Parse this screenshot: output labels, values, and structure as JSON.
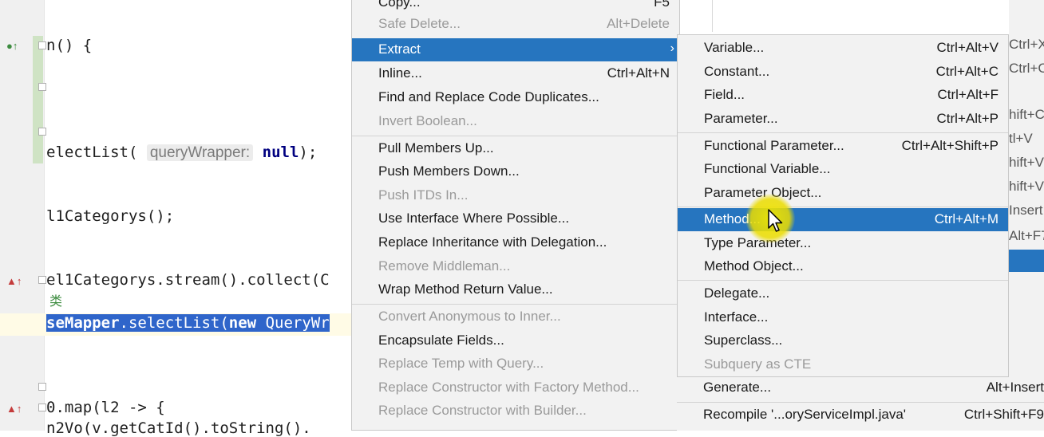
{
  "editor": {
    "lines": {
      "l1": "n() {",
      "l2_pre": "electList( ",
      "l2_hint": "queryWrapper:",
      "l2_kw": "null",
      "l2_post": ");",
      "l3": "l1Categorys();",
      "l4": "el1Categorys.stream().collect(C",
      "l5_cjk": "类",
      "l6_sel1": "seMapper",
      "l6_sel2": ".selectList(",
      "l6_sel3": "new",
      "l6_sel4": " QueryWr",
      "l7": "0.map(l2 -> {",
      "l8": "n2Vo(v.getCatId().toString()."
    }
  },
  "refactor_menu": {
    "items": [
      {
        "label": "Copy...",
        "shortcut": "F5"
      },
      {
        "label": "Safe Delete...",
        "shortcut": "Alt+Delete"
      },
      {
        "label": "Extract",
        "shortcut": "›"
      },
      {
        "label": "Inline...",
        "shortcut": "Ctrl+Alt+N"
      },
      {
        "label": "Find and Replace Code Duplicates...",
        "shortcut": ""
      },
      {
        "label": "Invert Boolean...",
        "shortcut": ""
      },
      {
        "label": "Pull Members Up...",
        "shortcut": ""
      },
      {
        "label": "Push Members Down...",
        "shortcut": ""
      },
      {
        "label": "Push ITDs In...",
        "shortcut": ""
      },
      {
        "label": "Use Interface Where Possible...",
        "shortcut": ""
      },
      {
        "label": "Replace Inheritance with Delegation...",
        "shortcut": ""
      },
      {
        "label": "Remove Middleman...",
        "shortcut": ""
      },
      {
        "label": "Wrap Method Return Value...",
        "shortcut": ""
      },
      {
        "label": "Convert Anonymous to Inner...",
        "shortcut": ""
      },
      {
        "label": "Encapsulate Fields...",
        "shortcut": ""
      },
      {
        "label": "Replace Temp with Query...",
        "shortcut": ""
      },
      {
        "label": "Replace Constructor with Factory Method...",
        "shortcut": ""
      },
      {
        "label": "Replace Constructor with Builder...",
        "shortcut": ""
      }
    ]
  },
  "extract_menu": {
    "items": [
      {
        "label": "Variable...",
        "shortcut": "Ctrl+Alt+V"
      },
      {
        "label": "Constant...",
        "shortcut": "Ctrl+Alt+C"
      },
      {
        "label": "Field...",
        "shortcut": "Ctrl+Alt+F"
      },
      {
        "label": "Parameter...",
        "shortcut": "Ctrl+Alt+P"
      },
      {
        "label": "Functional Parameter...",
        "shortcut": "Ctrl+Alt+Shift+P"
      },
      {
        "label": "Functional Variable...",
        "shortcut": ""
      },
      {
        "label": "Parameter Object...",
        "shortcut": ""
      },
      {
        "label": "Method...",
        "shortcut": "Ctrl+Alt+M"
      },
      {
        "label": "Type Parameter...",
        "shortcut": ""
      },
      {
        "label": "Method Object...",
        "shortcut": ""
      },
      {
        "label": "Delegate...",
        "shortcut": ""
      },
      {
        "label": "Interface...",
        "shortcut": ""
      },
      {
        "label": "Superclass...",
        "shortcut": ""
      },
      {
        "label": "Subquery as CTE",
        "shortcut": ""
      }
    ]
  },
  "parent_menu_tail": {
    "items": [
      {
        "label": "Generate...",
        "shortcut": "Alt+Insert"
      },
      {
        "label": "Recompile '...oryServiceImpl.java'",
        "shortcut": "Ctrl+Shift+F9"
      }
    ]
  },
  "right_panel": {
    "texts": [
      "Ctrl+X",
      "Ctrl+C",
      "hift+C",
      "tl+V",
      "hift+V",
      "hift+V",
      "Insert",
      "Alt+F7"
    ]
  },
  "colors": {
    "highlight": "#2675bf",
    "menu_bg": "#f2f2f2",
    "keyword": "#000080"
  }
}
